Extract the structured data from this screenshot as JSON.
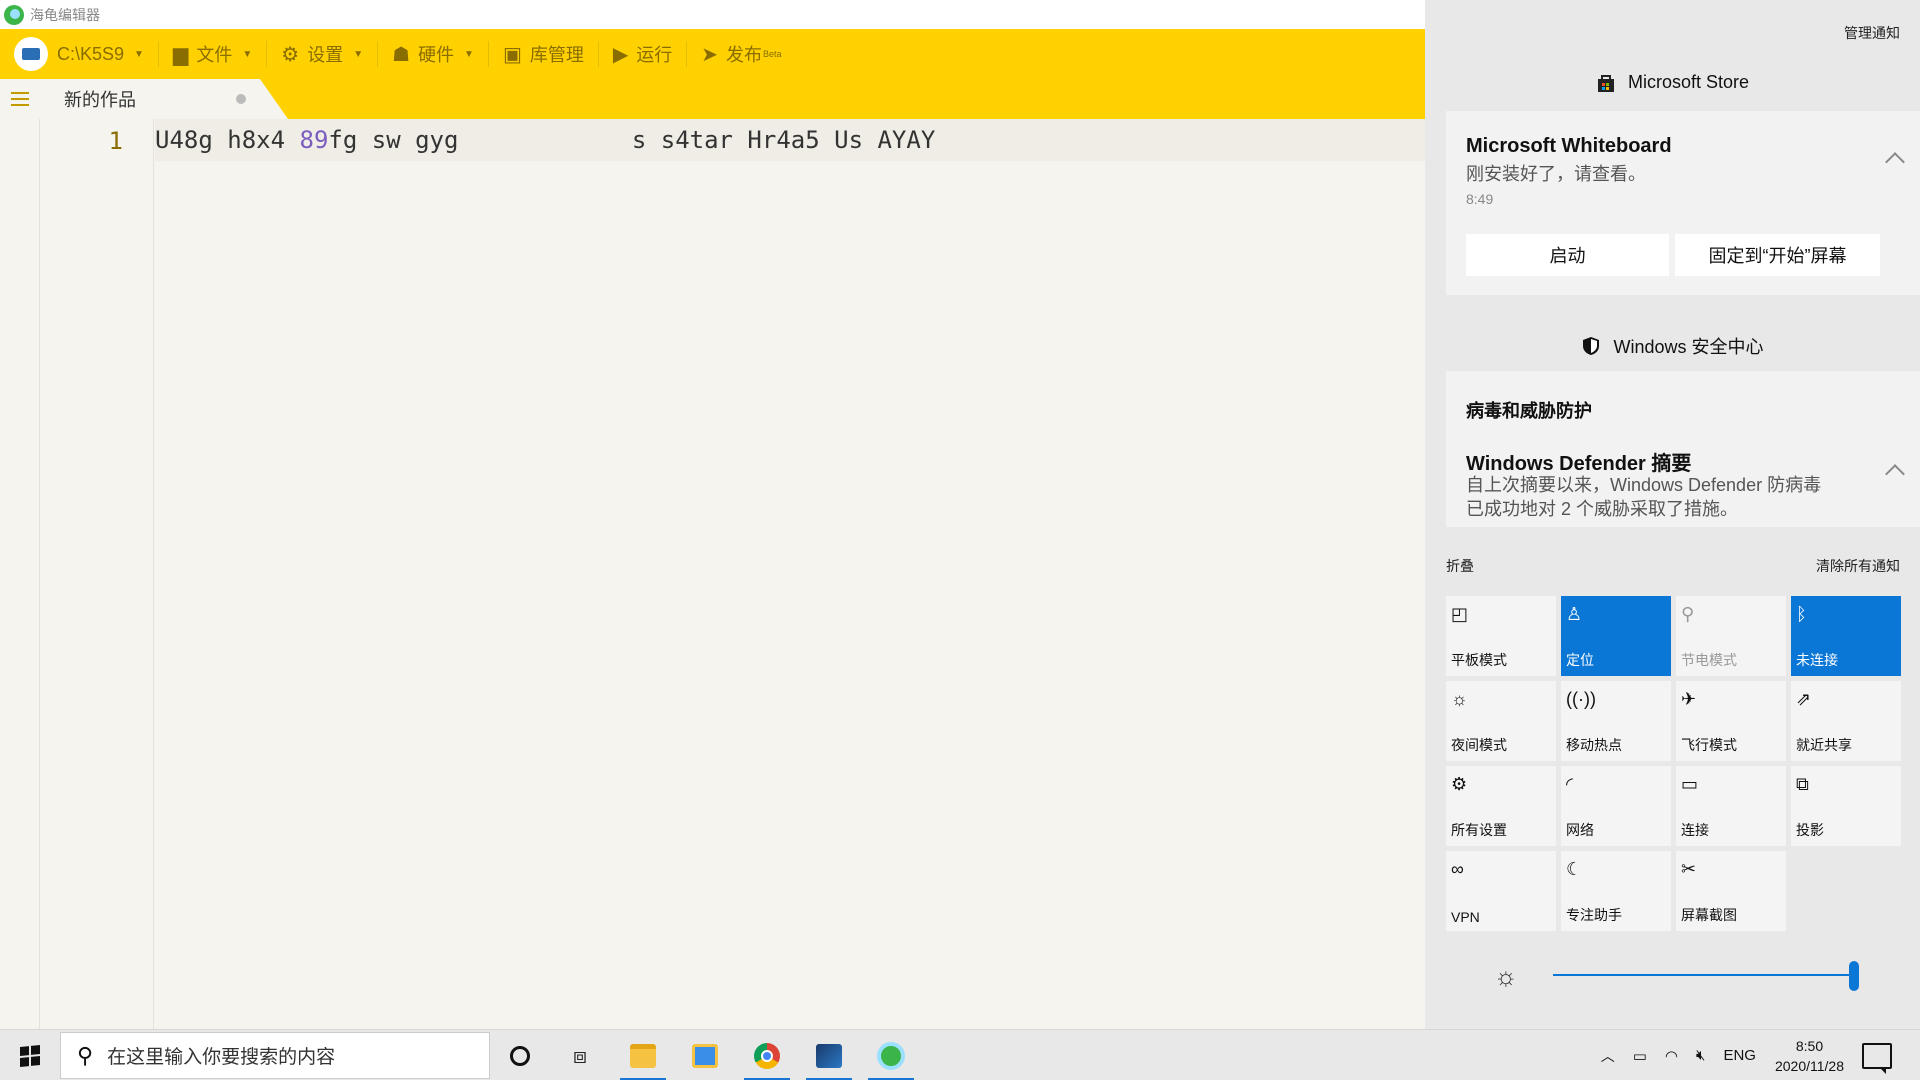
{
  "window": {
    "title": "海龟编辑器"
  },
  "toolbar": {
    "device_label": "C:\\K5S9",
    "file_label": "文件",
    "settings_label": "设置",
    "hardware_label": "硬件",
    "library_label": "库管理",
    "run_label": "运行",
    "publish_label": "发布",
    "publish_badge": "Beta"
  },
  "editor": {
    "tab_title": "新的作品",
    "line_number": "1",
    "code_before": "U48g h8x4 ",
    "code_number": "89",
    "code_after": "fg sw gyg            s s4tar Hr4a5 Us AYAY"
  },
  "action_center": {
    "manage_label": "管理通知",
    "store_group": {
      "title": "Microsoft Store",
      "notif_title": "Microsoft Whiteboard",
      "notif_body": "刚安装好了，请查看。",
      "notif_time": "8:49",
      "launch_button": "启动",
      "pin_button": "固定到“开始”屏幕"
    },
    "security_group": {
      "title": "Windows 安全中心",
      "section": "病毒和威胁防护",
      "notif_title": "Windows Defender 摘要",
      "notif_body_line1": "自上次摘要以来，Windows Defender 防病毒",
      "notif_body_line2": "已成功地对 2 个威胁采取了措施。"
    },
    "collapse_label": "折叠",
    "clear_all_label": "清除所有通知",
    "quick_actions": [
      {
        "label": "平板模式",
        "icon": "tablet-icon",
        "state": "off"
      },
      {
        "label": "定位",
        "icon": "location-icon",
        "state": "on"
      },
      {
        "label": "节电模式",
        "icon": "battery-saver-icon",
        "state": "disabled"
      },
      {
        "label": "未连接",
        "icon": "bluetooth-icon",
        "state": "on"
      },
      {
        "label": "夜间模式",
        "icon": "night-light-icon",
        "state": "off"
      },
      {
        "label": "移动热点",
        "icon": "hotspot-icon",
        "state": "off"
      },
      {
        "label": "飞行模式",
        "icon": "airplane-icon",
        "state": "off"
      },
      {
        "label": "就近共享",
        "icon": "nearby-share-icon",
        "state": "off"
      },
      {
        "label": "所有设置",
        "icon": "settings-gear-icon",
        "state": "off"
      },
      {
        "label": "网络",
        "icon": "network-icon",
        "state": "off"
      },
      {
        "label": "连接",
        "icon": "connect-icon",
        "state": "off"
      },
      {
        "label": "投影",
        "icon": "project-icon",
        "state": "off"
      },
      {
        "label": "VPN",
        "icon": "vpn-icon",
        "state": "off"
      },
      {
        "label": "专注助手",
        "icon": "focus-assist-icon",
        "state": "off"
      },
      {
        "label": "屏幕截图",
        "icon": "screen-snip-icon",
        "state": "off"
      }
    ],
    "brightness_level": 1.0
  },
  "taskbar": {
    "search_placeholder": "在这里输入你要搜索的内容",
    "language": "ENG",
    "time": "8:50",
    "date": "2020/11/28"
  },
  "colors": {
    "accent_yellow": "#ffd100",
    "accent_blue": "#0a76d6"
  }
}
